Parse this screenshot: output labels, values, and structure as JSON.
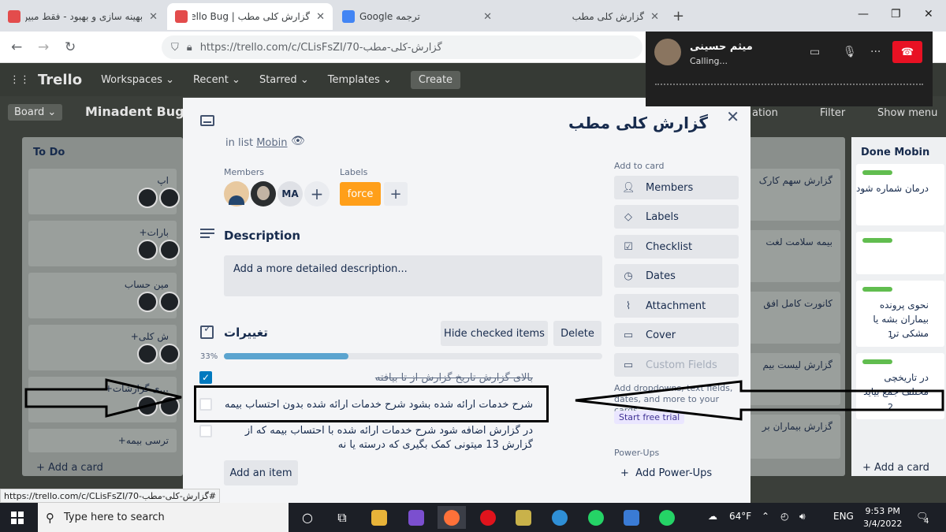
{
  "browser": {
    "tabs": [
      {
        "title": "بهینه سازی و بهبود - فقط مبین c",
        "active": false,
        "icon": "trello-favicon",
        "color": "#e34c4c"
      },
      {
        "title": "گزارش کلی مطب | Trello Bug",
        "active": true,
        "icon": "trello-favicon",
        "color": "#e34c4c"
      },
      {
        "title": "Google ترجمه",
        "active": false,
        "icon": "google-translate-icon",
        "color": "#4285f4"
      },
      {
        "title": "گزارش کلی مطب",
        "active": false,
        "icon": "",
        "color": ""
      }
    ],
    "address": {
      "url": "https://trello.com/c/CLisFsZI/70-گزارش-کلی-مطب"
    }
  },
  "trello_header": {
    "logo": "Trello",
    "menus": [
      "Workspaces",
      "Recent",
      "Starred",
      "Templates"
    ],
    "create": "Create"
  },
  "board_bar": {
    "view": "Board",
    "name": "Minadent Bug",
    "automation": "ation",
    "filter": "Filter",
    "show_menu": "Show menu"
  },
  "todo_list": {
    "title": "To Do",
    "cards": [
      "اپ",
      "بارات+",
      "مین حساب",
      "ش کلی+",
      "...ی گزارشات+",
      "ترسی بیمه+"
    ],
    "add_card": "+ Add a card"
  },
  "middle_list": {
    "cards": [
      "گزارش سهم کارک",
      "بیمه سلامت لغت",
      "کانورت کامل افق",
      "گزارش لیست بیم",
      "گزارش بیماران بر"
    ]
  },
  "done_list": {
    "title": "Done Mobin",
    "cards": [
      {
        "text": "درمان شماره شود",
        "badge": ""
      },
      {
        "text": "",
        "badge": ""
      },
      {
        "text": "نحوی پرونده بیماران بشه یا مشکی تر",
        "badge": "1"
      },
      {
        "text": "در تاریخچی مختلف جمع بیاید",
        "badge": "2"
      }
    ],
    "add_card": "+ Add a card"
  },
  "card_modal": {
    "title": "گزارش کلی مطب",
    "in_list_prefix": "in list",
    "list_name": "Mobin",
    "members_label": "Members",
    "members": [
      {
        "initials": ""
      },
      {
        "initials": ""
      },
      {
        "initials": "MA"
      }
    ],
    "labels_label": "Labels",
    "labels": [
      {
        "name": "force",
        "color": "#ff9f1a"
      }
    ],
    "description_heading": "Description",
    "description_placeholder": "Add a more detailed description...",
    "checklist": {
      "title": "تغییرات",
      "hide_checked": "Hide checked items",
      "delete": "Delete",
      "progress_label": "33%",
      "progress": 0.33,
      "items": [
        {
          "text": "بالای گزارش تاریخ گزارش از تا بیافته",
          "checked": true
        },
        {
          "text": "شرح خدمات ارائه شده بشود شرح خدمات ارائه شده بدون احتساب بیمه",
          "checked": false
        },
        {
          "text": "در گزارش اضافه شود شرح خدمات ارائه شده با احتساب بیمه که از گزارش 13 میتونی کمک بگیری که درسته یا نه",
          "checked": false
        }
      ],
      "add_item": "Add an item"
    },
    "sidebar": {
      "add_to_card_heading": "Add to card",
      "buttons": [
        "Members",
        "Labels",
        "Checklist",
        "Dates",
        "Attachment",
        "Cover",
        "Custom Fields"
      ],
      "custom_fields_note": "Add dropdowns, text fields, dates, and more to your cards.",
      "trial": "Start free trial",
      "powerups_heading": "Power-Ups",
      "add_powerups": "Add Power-Ups"
    }
  },
  "call": {
    "name": "میثم حسینی",
    "status": "Calling..."
  },
  "status_bar": {
    "url": "https://trello.com/c/CLisFsZI/70-گزارش-کلی-مطب#"
  },
  "taskbar": {
    "search_placeholder": "Type here to search",
    "weather": "64°F",
    "language": "ENG",
    "time": "9:53 PM",
    "date": "3/4/2022",
    "notifications": "4"
  },
  "colors": {
    "accent": "#0079bf",
    "label_force": "#ff9f1a",
    "progress": "#5ba4cf",
    "done_label": "#61bd4f",
    "hangup": "#e81123"
  }
}
